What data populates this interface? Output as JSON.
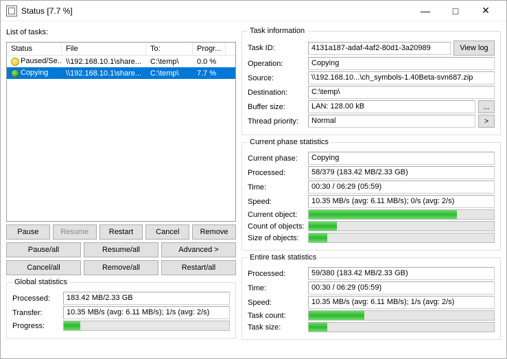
{
  "window": {
    "title": "Status [7.7 %]"
  },
  "list": {
    "label": "List of tasks:",
    "headers": {
      "status": "Status",
      "file": "File",
      "to": "To:",
      "prog": "Progr..."
    },
    "rows": [
      {
        "icon": "y",
        "status": "Paused/Se...",
        "file": "\\\\192.168.10.1\\share...",
        "to": "C:\\temp\\",
        "prog": "0.0 %",
        "sel": false
      },
      {
        "icon": "g",
        "status": "Copying",
        "file": "\\\\192.168.10.1\\share...",
        "to": "C:\\temp\\",
        "prog": "7.7 %",
        "sel": true
      }
    ]
  },
  "buttons": {
    "pause": "Pause",
    "resume": "Resume",
    "restart": "Restart",
    "cancel": "Cancel",
    "remove": "Remove",
    "pause_all": "Pause/all",
    "resume_all": "Resume/all",
    "advanced": "Advanced >",
    "cancel_all": "Cancel/all",
    "remove_all": "Remove/all",
    "restart_all": "Restart/all"
  },
  "global": {
    "legend": "Global statistics",
    "processed_k": "Processed:",
    "processed_v": "183.42 MB/2.33 GB",
    "transfer_k": "Transfer:",
    "transfer_v": "10.35 MB/s (avg: 6.11 MB/s); 1/s (avg: 2/s)",
    "progress_k": "Progress:",
    "progress_pct": 10
  },
  "taskinfo": {
    "legend": "Task information",
    "taskid_k": "Task ID:",
    "taskid_v": "4131a187-adaf-4af2-80d1-3a20989",
    "viewlog": "View log",
    "operation_k": "Operation:",
    "operation_v": "Copying",
    "source_k": "Source:",
    "source_v": "\\\\192.168.10...\\ch_symbols-1.40Beta-svn687.zip",
    "dest_k": "Destination:",
    "dest_v": "C:\\temp\\",
    "buffer_k": "Buffer size:",
    "buffer_v": "LAN: 128.00 kB",
    "buffer_btn": "...",
    "thread_k": "Thread priority:",
    "thread_v": "Normal",
    "thread_btn": ">"
  },
  "phase": {
    "legend": "Current phase statistics",
    "phase_k": "Current phase:",
    "phase_v": "Copying",
    "processed_k": "Processed:",
    "processed_v": "58/379 (183.42 MB/2.33 GB)",
    "time_k": "Time:",
    "time_v": "00:30 / 06:29 (05:59)",
    "speed_k": "Speed:",
    "speed_v": "10.35 MB/s (avg: 6.11 MB/s); 0/s (avg: 2/s)",
    "curobj_k": "Current object:",
    "curobj_pct": 80,
    "countobj_k": "Count of objects:",
    "countobj_pct": 15,
    "sizeobj_k": "Size of objects:",
    "sizeobj_pct": 10
  },
  "entire": {
    "legend": "Entire task statistics",
    "processed_k": "Processed:",
    "processed_v": "59/380 (183.42 MB/2.33 GB)",
    "time_k": "Time:",
    "time_v": "00:30 / 06:29 (05:59)",
    "speed_k": "Speed:",
    "speed_v": "10.35 MB/s (avg: 6.11 MB/s); 1/s (avg: 2/s)",
    "taskcount_k": "Task count:",
    "taskcount_pct": 30,
    "tasksize_k": "Task size:",
    "tasksize_pct": 10
  }
}
